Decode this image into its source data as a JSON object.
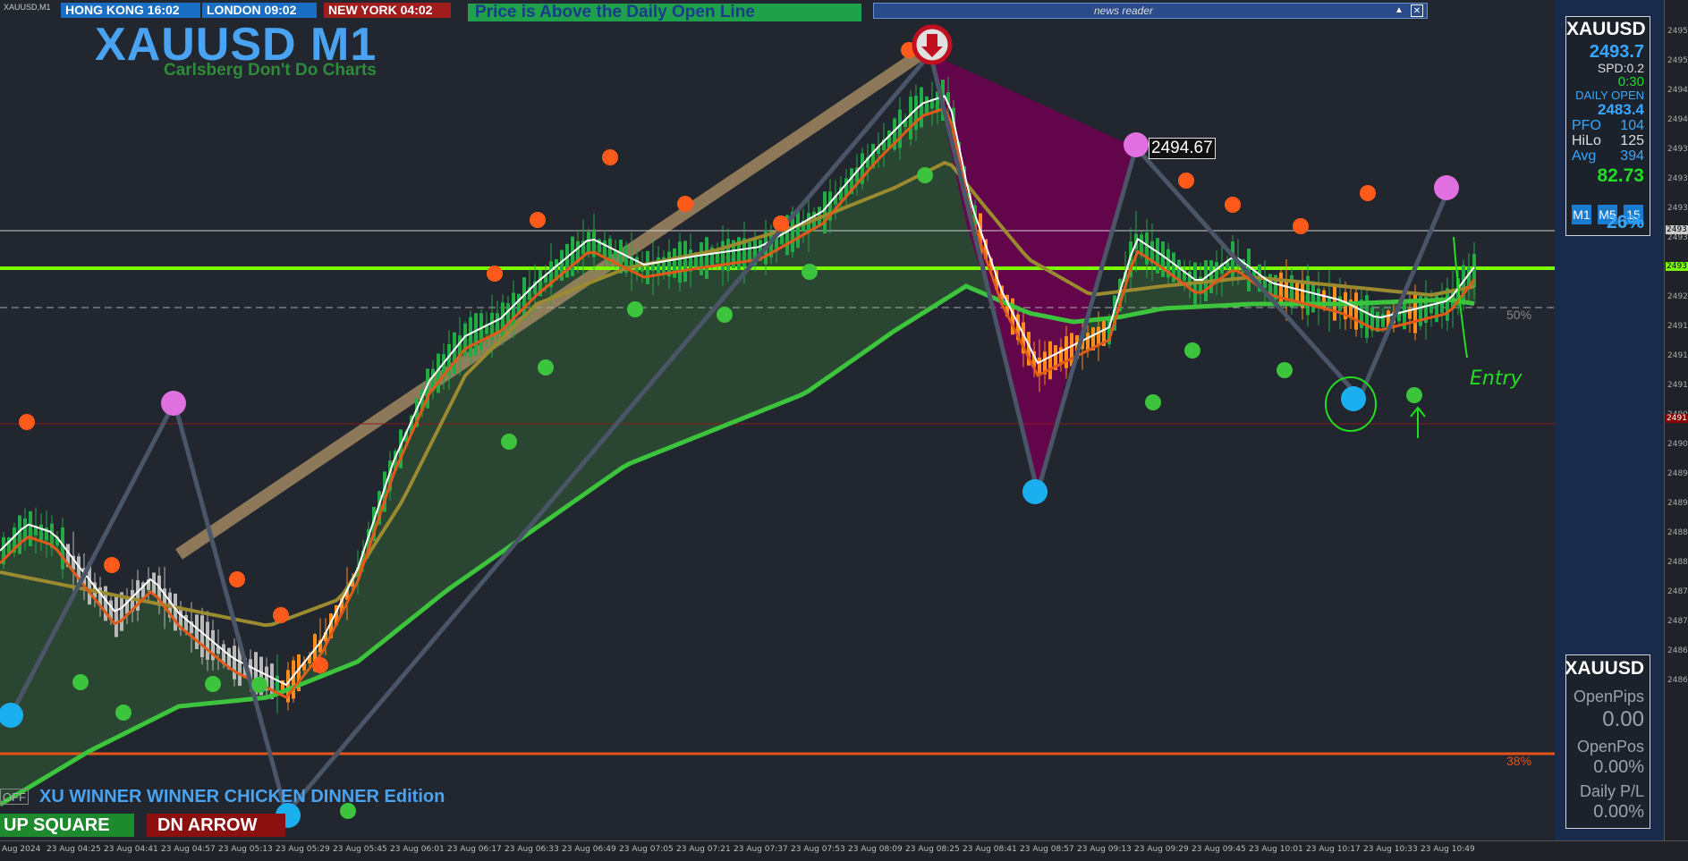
{
  "window": {
    "symbol_tag": "XAUUSD,M1"
  },
  "clocks": [
    {
      "label": "HONG KONG 16:02",
      "bg": "#1a6fc4"
    },
    {
      "label": "LONDON  09:02",
      "bg": "#1a6fc4"
    },
    {
      "label": "NEW YORK  04:02",
      "bg": "#a11c1c"
    }
  ],
  "banner": {
    "text": "Price is Above the Daily Open Line",
    "bg": "#1fa04a"
  },
  "news_reader": {
    "title": "news reader",
    "collapse_icon": "triangle-up-icon",
    "close_icon": "close-icon"
  },
  "title": {
    "main": "XAUUSD M1",
    "sub": "Carlsberg Don't Do Charts"
  },
  "price_tag": "2494.67",
  "level_labels": {
    "fifty": "50%",
    "thirtyeight": "38%"
  },
  "stats_panel": {
    "symbol": "XAUUSD",
    "price": "2493.7",
    "spread": "SPD:0.2",
    "timer": "0:30",
    "daily_open_label": "DAILY OPEN",
    "daily_open": "2483.4",
    "pfo_label": "PFO",
    "pfo": "104",
    "hilo_label": "HiLo",
    "hilo": "125",
    "avg_label": "Avg",
    "avg": "394",
    "big_value": "82.73",
    "timeframes": [
      "M1",
      "M5",
      "15"
    ],
    "percent": "26%"
  },
  "pl_panel": {
    "symbol": "XAUUSD",
    "openpips_label": "OpenPips",
    "openpips": "0.00",
    "openpos_label": "OpenPos",
    "openpos": "0.00%",
    "daily_label": "Daily P/L",
    "daily": "0.00%"
  },
  "bottom": {
    "off": "OFF",
    "edition": "XU WINNER WINNER CHICKEN DINNER Edition",
    "up": "UP SQUARE",
    "dn": "DN ARROW"
  },
  "annotation": {
    "text": "Entry"
  },
  "price_axis": [
    "2495.",
    "2495.",
    "2494.",
    "2494.",
    "2493.",
    "2493.",
    "2493.",
    "2493.",
    "2492.",
    "2492.",
    "2491.",
    "2491.",
    "2491.",
    "2490.",
    "2490.",
    "2489.",
    "2489.",
    "2488.",
    "2488.",
    "2487.",
    "2487.",
    "2486.",
    "2486."
  ],
  "price_axis_marks": [
    {
      "text": "2493.",
      "bg": "#ccc",
      "color": "#000"
    },
    {
      "text": "2493.",
      "bg": "#7cfc00",
      "color": "#000"
    },
    {
      "text": "2491.",
      "bg": "#8b0000",
      "color": "#fff"
    }
  ],
  "time_axis": [
    "Aug 2024",
    "23 Aug 04:25",
    "23 Aug 04:41",
    "23 Aug 04:57",
    "23 Aug 05:13",
    "23 Aug 05:29",
    "23 Aug 05:45",
    "23 Aug 06:01",
    "23 Aug 06:17",
    "23 Aug 06:33",
    "23 Aug 06:49",
    "23 Aug 07:05",
    "23 Aug 07:21",
    "23 Aug 07:37",
    "23 Aug 07:53",
    "23 Aug 08:09",
    "23 Aug 08:25",
    "23 Aug 08:41",
    "23 Aug 08:57",
    "23 Aug 09:13",
    "23 Aug 09:29",
    "23 Aug 09:45",
    "23 Aug 10:01",
    "23 Aug 10:17",
    "23 Aug 10:33",
    "23 Aug 10:49"
  ],
  "colors": {
    "bull": "#22aa44",
    "bear": "#ff8c1a",
    "neutral": "#b8b8b8",
    "daily_open": "#7cfc00",
    "zigzag": "#4a5568"
  }
}
